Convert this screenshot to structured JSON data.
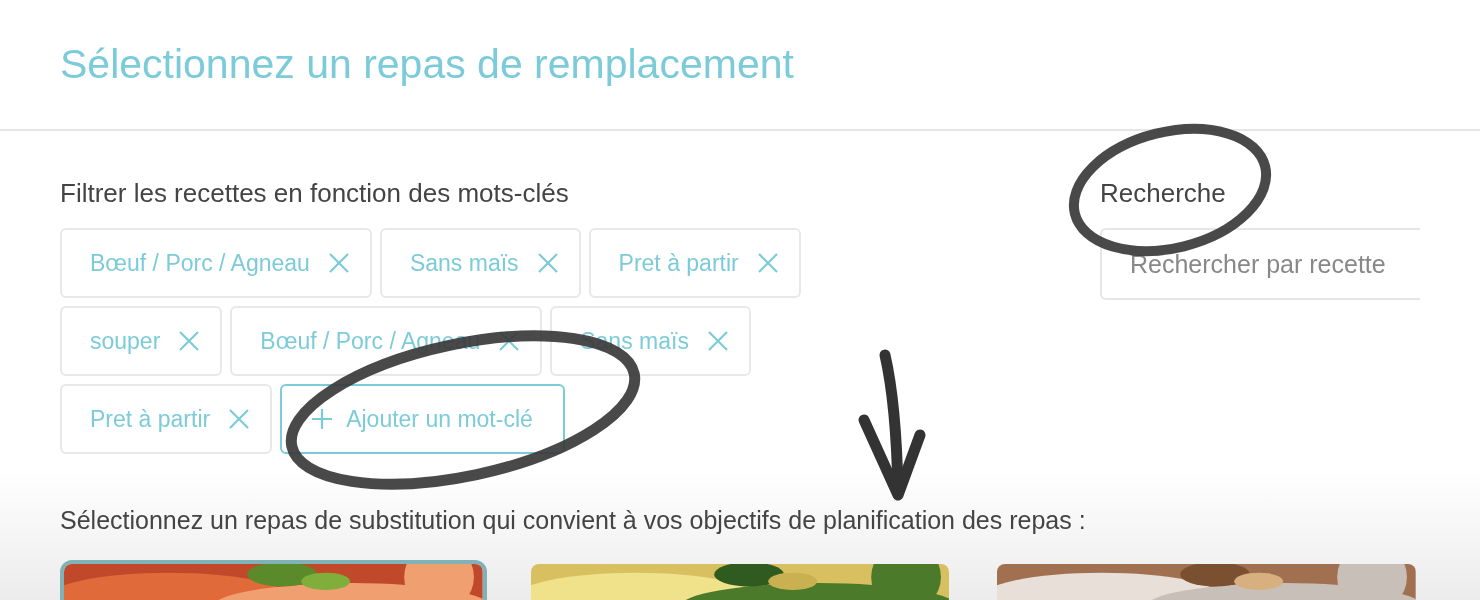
{
  "title": "Sélectionnez un repas de remplacement",
  "filter": {
    "label": "Filtrer les recettes en fonction des mots-clés",
    "tags": [
      {
        "label": "Bœuf / Porc / Agneau"
      },
      {
        "label": "Sans maïs"
      },
      {
        "label": "Pret à partir"
      },
      {
        "label": "souper"
      },
      {
        "label": "Bœuf / Porc / Agneau"
      },
      {
        "label": "Sans maïs"
      },
      {
        "label": "Pret à partir"
      }
    ],
    "add_button": {
      "label": "Ajouter un mot-clé"
    }
  },
  "search": {
    "label": "Recherche",
    "placeholder": "Rechercher par recette"
  },
  "prompt": "Sélectionnez un repas de substitution qui convient à vos objectifs de planification des repas :",
  "meals": [
    {
      "selected": true
    },
    {
      "selected": false
    },
    {
      "selected": false
    }
  ]
}
